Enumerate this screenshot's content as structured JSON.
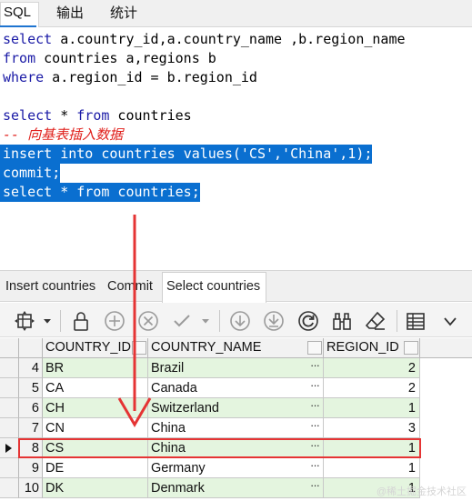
{
  "top_tabs": [
    {
      "label": "SQL"
    },
    {
      "label": "输出"
    },
    {
      "label": "统计"
    }
  ],
  "editor": {
    "line1": {
      "kw": "select",
      "rest": " a.country_id,a.country_name ,b.region_name"
    },
    "line2": {
      "kw": "from",
      "rest": " countries a,regions b"
    },
    "line3": {
      "kw": "where",
      "rest": " a.region_id = b.region_id"
    },
    "line5": {
      "kw": "select",
      "mid": " * ",
      "kw2": "from",
      "rest": " countries"
    },
    "comment": "-- 向基表插入数据",
    "sel1": {
      "kw": "insert into",
      "rest": " countries ",
      "kw2": "values",
      "rest2": "('CS','China',1);"
    },
    "sel2": {
      "kw": "commit",
      "rest": ";"
    },
    "sel3": {
      "kw": "select",
      "mid": " * ",
      "kw2": "from",
      "rest": " countries;"
    }
  },
  "bottom_tabs": [
    {
      "label": "Insert countries"
    },
    {
      "label": "Commit"
    },
    {
      "label": "Select countries"
    }
  ],
  "toolbar_icons": [
    "grid-menu-icon",
    "lock-icon",
    "add-record-icon",
    "delete-record-icon",
    "post-edit-icon",
    "fetch-next-icon",
    "fetch-last-icon",
    "refresh-icon",
    "query-by-example-icon",
    "clear-icon",
    "single-record-view-icon",
    "more-options-icon"
  ],
  "grid": {
    "columns": [
      "COUNTRY_ID",
      "COUNTRY_NAME",
      "REGION_ID"
    ],
    "rows": [
      {
        "num": "4",
        "id": "BR",
        "name": "Brazil",
        "region": "2"
      },
      {
        "num": "5",
        "id": "CA",
        "name": "Canada",
        "region": "2"
      },
      {
        "num": "6",
        "id": "CH",
        "name": "Switzerland",
        "region": "1"
      },
      {
        "num": "7",
        "id": "CN",
        "name": "China",
        "region": "3"
      },
      {
        "num": "8",
        "id": "CS",
        "name": "China",
        "region": "1"
      },
      {
        "num": "9",
        "id": "DE",
        "name": "Germany",
        "region": "1"
      },
      {
        "num": "10",
        "id": "DK",
        "name": "Denmark",
        "region": "1"
      }
    ],
    "selected_row": "8",
    "ellipsis": "···"
  },
  "colors": {
    "selection": "#0a6fd0",
    "keyword": "#1a1aa6",
    "comment": "#e0201c",
    "annotation": "#e53434",
    "changed_cell": "#e4f5df"
  },
  "watermark": "@稀土掘金技术社区"
}
